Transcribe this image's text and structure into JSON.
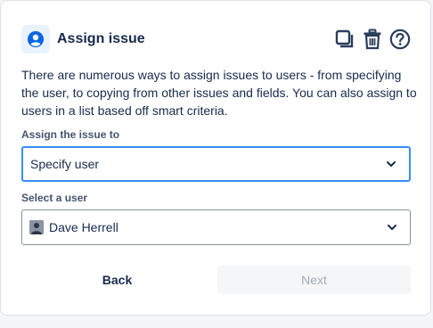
{
  "header": {
    "title": "Assign issue",
    "icon": "user-circle-icon",
    "actions": [
      "copy-icon",
      "trash-icon",
      "help-icon"
    ]
  },
  "description": "There are numerous ways to assign issues to users - from specifying the user, to copying from other issues and fields. You can also assign to users in a list based off smart criteria.",
  "assign_field": {
    "label": "Assign the issue to",
    "value": "Specify user"
  },
  "user_field": {
    "label": "Select a user",
    "value": "Dave Herrell"
  },
  "footer": {
    "back_label": "Back",
    "next_label": "Next"
  },
  "colors": {
    "accent": "#0c66e4",
    "focus_border": "#388bff",
    "text": "#172b4d"
  }
}
